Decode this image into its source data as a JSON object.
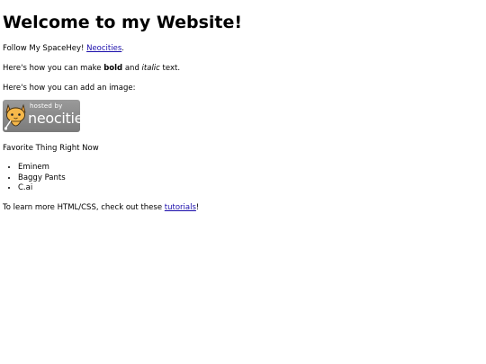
{
  "page": {
    "heading": "Welcome to my Website!",
    "follow_prefix": "Follow My SpaceHey! ",
    "follow_link": "Neocities",
    "follow_suffix": ".",
    "bold_prefix": "Here's how you can make ",
    "bold_word": "bold",
    "bold_middle": " and ",
    "italic_word": "italic",
    "bold_suffix": " text.",
    "image_text": "Here's how you can add an image:",
    "badge": {
      "hosted_text": "hosted by",
      "brand_text": "neocities"
    },
    "favorites_label": "Favorite Thing Right Now",
    "favorites": [
      "Eminem",
      "Baggy Pants",
      "C.ai"
    ],
    "learn_prefix": "To learn more HTML/CSS, check out these ",
    "learn_link": "tutorials",
    "learn_suffix": "!"
  },
  "colors": {
    "link": "#1a0dab",
    "text": "#000000",
    "background": "#ffffff",
    "badge": "#8a8a8a"
  }
}
